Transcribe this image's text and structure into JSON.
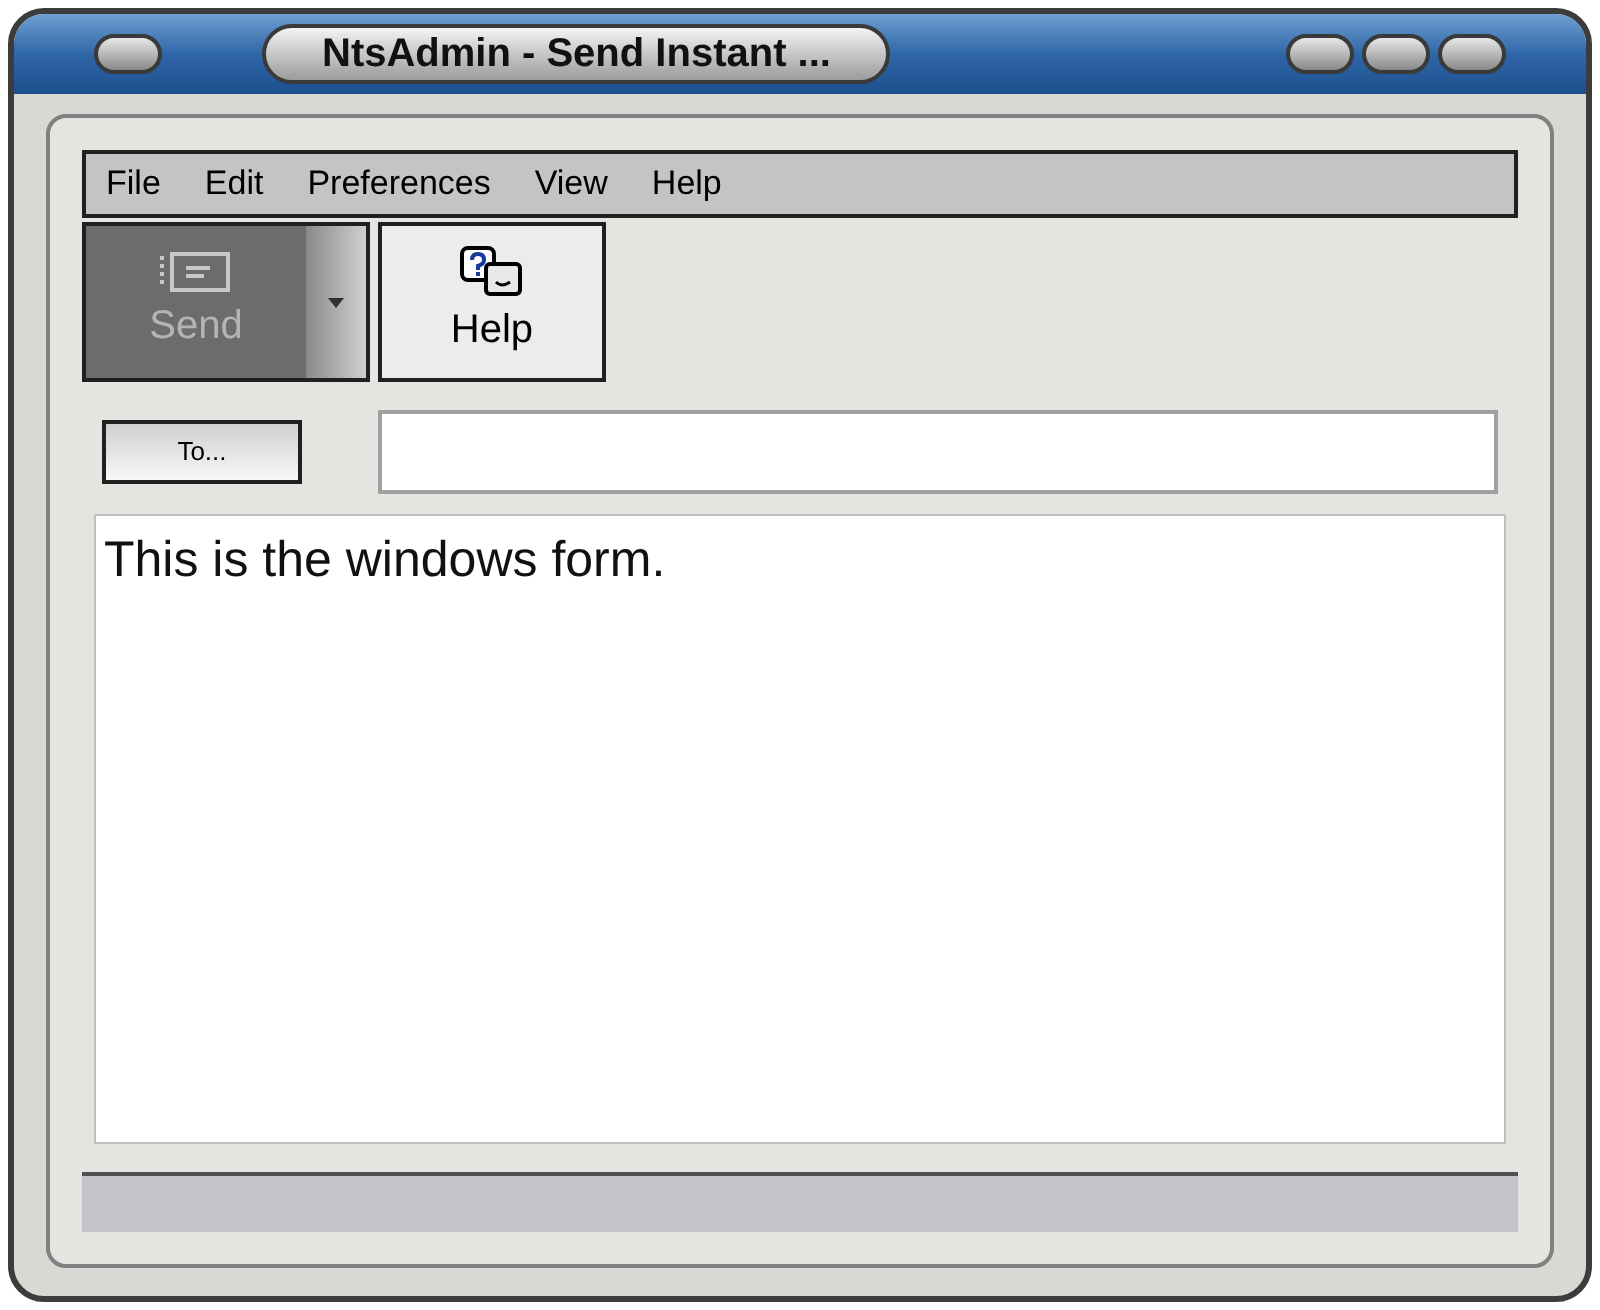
{
  "window": {
    "title": "NtsAdmin - Send Instant ..."
  },
  "menu": [
    "File",
    "Edit",
    "Preferences",
    "View",
    "Help"
  ],
  "toolbar": [
    {
      "label": "Send",
      "kind": "send",
      "disabled": true
    },
    {
      "label": "Help",
      "kind": "help",
      "disabled": false
    }
  ],
  "to_button": "To...",
  "message": "This is the windows form."
}
